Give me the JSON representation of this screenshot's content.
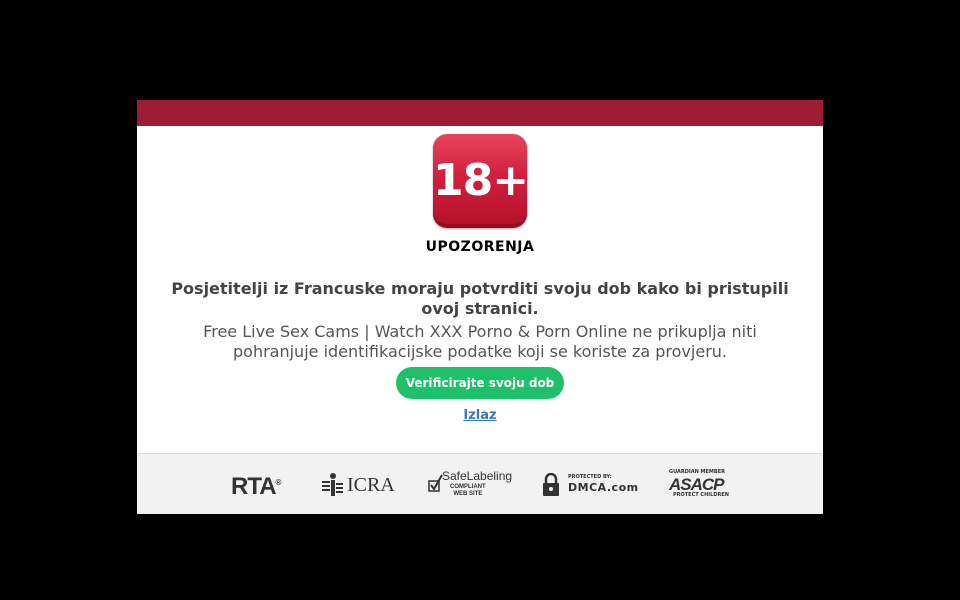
{
  "modal": {
    "badge_text": "18+",
    "warning_title": "UPOZORENJA",
    "headline": "Posjetitelji iz Francuske moraju potvrditi svoju dob kako bi pristupili ovoj stranici.",
    "subtext": "Free Live Sex Cams | Watch XXX Porno & Porn Online ne prikuplja niti pohranjuje identifikacijske podatke koji se koriste za provjeru.",
    "verify_button_label": "Verificirajte svoju dob",
    "exit_link_label": "Izlaz"
  },
  "footer": {
    "logos": {
      "rta": {
        "text": "RTA",
        "mark": "®"
      },
      "icra": {
        "text": "ICRA"
      },
      "safelabeling": {
        "line1": "SafeLabeling",
        "line2": "COMPLIANT",
        "line3": "WEB SITE"
      },
      "dmca": {
        "line1": "PROTECTED BY:",
        "line2": "DMCA.com"
      },
      "asacp": {
        "line1": "GUARDIAN MEMBER",
        "line2": "ASACP",
        "line3": "PROTECT CHILDREN"
      }
    }
  },
  "colors": {
    "header_bar": "#9e1c33",
    "badge": "#d11f3e",
    "verify_button": "#1ec16a",
    "exit_link": "#3a77b8"
  }
}
